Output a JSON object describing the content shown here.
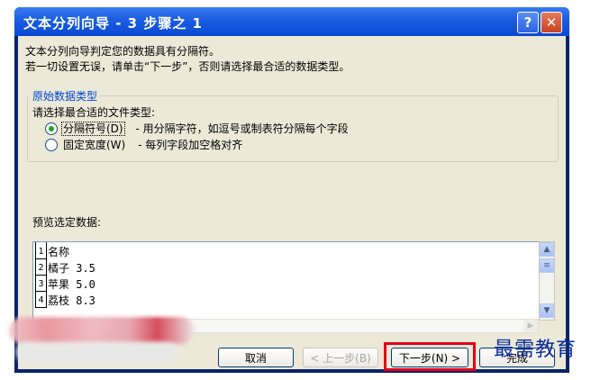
{
  "window": {
    "title": "文本分列向导 - 3 步骤之 1",
    "help_glyph": "?",
    "close_glyph": "✕"
  },
  "intro": {
    "line1": "文本分列向导判定您的数据具有分隔符。",
    "line2": "若一切设置无误，请单击“下一步”，否则请选择最合适的数据类型。"
  },
  "group": {
    "legend": "原始数据类型",
    "prompt": "请选择最合适的文件类型:",
    "options": [
      {
        "label": "分隔符号(D)",
        "desc": "- 用分隔字符，如逗号或制表符分隔每个字段",
        "selected": true
      },
      {
        "label": "固定宽度(W)",
        "desc": "- 每列字段加空格对齐",
        "selected": false
      }
    ]
  },
  "preview": {
    "label": "预览选定数据:",
    "rows": [
      {
        "num": "1",
        "text": "名称"
      },
      {
        "num": "2",
        "text": "橘子 3.5"
      },
      {
        "num": "3",
        "text": "苹果 5.0"
      },
      {
        "num": "4",
        "text": "荔枝 8.3"
      }
    ]
  },
  "buttons": {
    "cancel": "取消",
    "back": "< 上一步(B)",
    "next": "下一步(N) >",
    "finish": "完成"
  },
  "watermark": "最需教育"
}
